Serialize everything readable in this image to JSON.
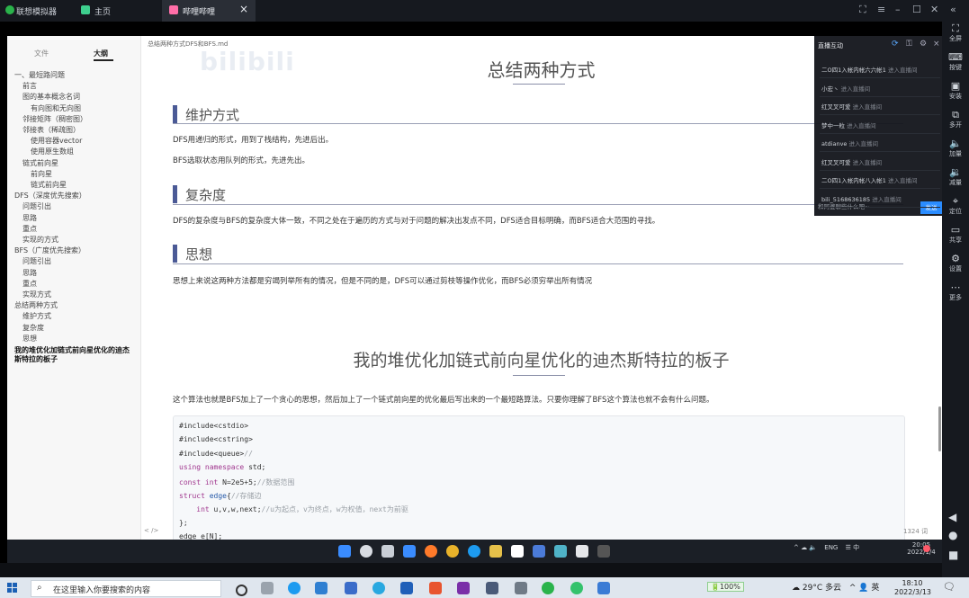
{
  "emulator": {
    "brand": "联想模拟器",
    "home": "主页",
    "tab_label": "哔哩哔哩",
    "tab_close": "×",
    "controls": [
      "⛶",
      "≡",
      "–",
      "☐",
      "✕",
      "«"
    ]
  },
  "rail": [
    {
      "icon": "⛶",
      "label": "全屏"
    },
    {
      "icon": "⌨",
      "label": "按键"
    },
    {
      "icon": "▣",
      "label": "安装"
    },
    {
      "icon": "⧉",
      "label": "多开"
    },
    {
      "icon": "🔈",
      "label": "加量"
    },
    {
      "icon": "🔉",
      "label": "减量"
    },
    {
      "icon": "⌖",
      "label": "定位"
    },
    {
      "icon": "▭",
      "label": "共享"
    },
    {
      "icon": "⚙",
      "label": "设置"
    },
    {
      "icon": "⋯",
      "label": "更多"
    }
  ],
  "nav_buttons": [
    "◀",
    "●",
    "■"
  ],
  "sidebar": {
    "tabs": [
      "文件",
      "大纲"
    ],
    "toc": [
      "一、最短路问题",
      "前言",
      "图的基本概念名词",
      "有向图和无向图",
      "邻接矩阵（稠密图）",
      "邻接表（稀疏图）",
      "使用容器vector",
      "使用原生数组",
      "链式前向星",
      "前向星",
      "链式前向星",
      "DFS（深度优先搜索）",
      "问题引出",
      "思路",
      "重点",
      "实现的方式",
      "BFS（广度优先搜索）",
      "问题引出",
      "思路",
      "重点",
      "实现方式",
      "总结两种方式",
      "维护方式",
      "复杂度",
      "思想",
      "我的堆优化加链式前向星优化的迪杰斯特拉的板子"
    ]
  },
  "doc": {
    "filename": "总结两种方式DFS和BFS.md",
    "watermark": "bilibili",
    "h1_main": "总结两种方式",
    "sec1_title": "维护方式",
    "sec1_p1": "DFS用递归的形式，用到了栈结构，先进后出。",
    "sec1_p2": "BFS选取状态用队列的形式，先进先出。",
    "sec2_title": "复杂度",
    "sec2_p": "DFS的复杂度与BFS的复杂度大体一致，不同之处在于遍历的方式与对于问题的解决出发点不同，DFS适合目标明确，而BFS适合大范围的寻找。",
    "sec3_title": "思想",
    "sec3_p": "思想上来说这两种方法都是穷竭列举所有的情况，但是不同的是，DFS可以通过剪枝等操作优化，而BFS必须穷举出所有情况",
    "h1_second": "我的堆优化加链式前向星优化的迪杰斯特拉的板子",
    "intro": "这个算法也就是BFS加上了一个贪心的思想，然后加上了一个链式前向星的优化最后写出来的一个最短路算法。只要你理解了BFS这个算法也就不会有什么问题。",
    "footer_left": "<  />",
    "footer_right": "1324 词"
  },
  "code_lines": [
    [
      {
        "t": "#include<cstdio>",
        "c": ""
      }
    ],
    [
      {
        "t": "#include<cstring>",
        "c": ""
      }
    ],
    [
      {
        "t": "#include<queue>",
        "c": ""
      },
      {
        "t": "//",
        "c": "cm"
      }
    ],
    [
      {
        "t": "using namespace ",
        "c": "kw"
      },
      {
        "t": "std;",
        "c": ""
      }
    ],
    [
      {
        "t": "const int ",
        "c": "kw"
      },
      {
        "t": "N=2e5+5;",
        "c": ""
      },
      {
        "t": "//数据范围",
        "c": "cm"
      }
    ],
    [
      {
        "t": "struct ",
        "c": "kw"
      },
      {
        "t": "edge",
        "c": "ty"
      },
      {
        "t": "{",
        "c": ""
      },
      {
        "t": "//存储边",
        "c": "cm"
      }
    ],
    [
      {
        "t": "    int ",
        "c": "kw"
      },
      {
        "t": "u,v,w,next;",
        "c": ""
      },
      {
        "t": "//u为起点，v为终点，w为权值，next为前驱",
        "c": "cm"
      }
    ],
    [
      {
        "t": "};",
        "c": ""
      }
    ],
    [
      {
        "t": "edge e[N];",
        "c": ""
      }
    ]
  ],
  "chat": {
    "title": "直播互动",
    "rows": [
      {
        "name": "二O四1入帐内帐六六帐1",
        "action": "进入直播间"
      },
      {
        "name": "小宏丶",
        "action": "进入直播间"
      },
      {
        "name": "红叉叉可爱",
        "action": "进入直播间"
      },
      {
        "name": "梦中一粒",
        "action": "进入直播间"
      },
      {
        "name": "atdianve",
        "action": "进入直播间"
      },
      {
        "name": "红叉叉可爱",
        "action": "进入直播间"
      },
      {
        "name": "二O四1入帐内帐八入帐1",
        "action": "进入直播间"
      },
      {
        "name": "bili_5168636185",
        "action": "进入直播间"
      }
    ],
    "input_placeholder": "和阿婆聊些什么吧~",
    "send_label": "发送"
  },
  "emu_tray": {
    "lang": "ENG",
    "time": "20:05",
    "date": "2022/1/4"
  },
  "windows": {
    "search_placeholder": "在这里输入你要搜索的内容",
    "battery": "100%",
    "weather": "29°C 多云",
    "ime": "英",
    "time": "18:10",
    "date": "2022/3/13"
  }
}
